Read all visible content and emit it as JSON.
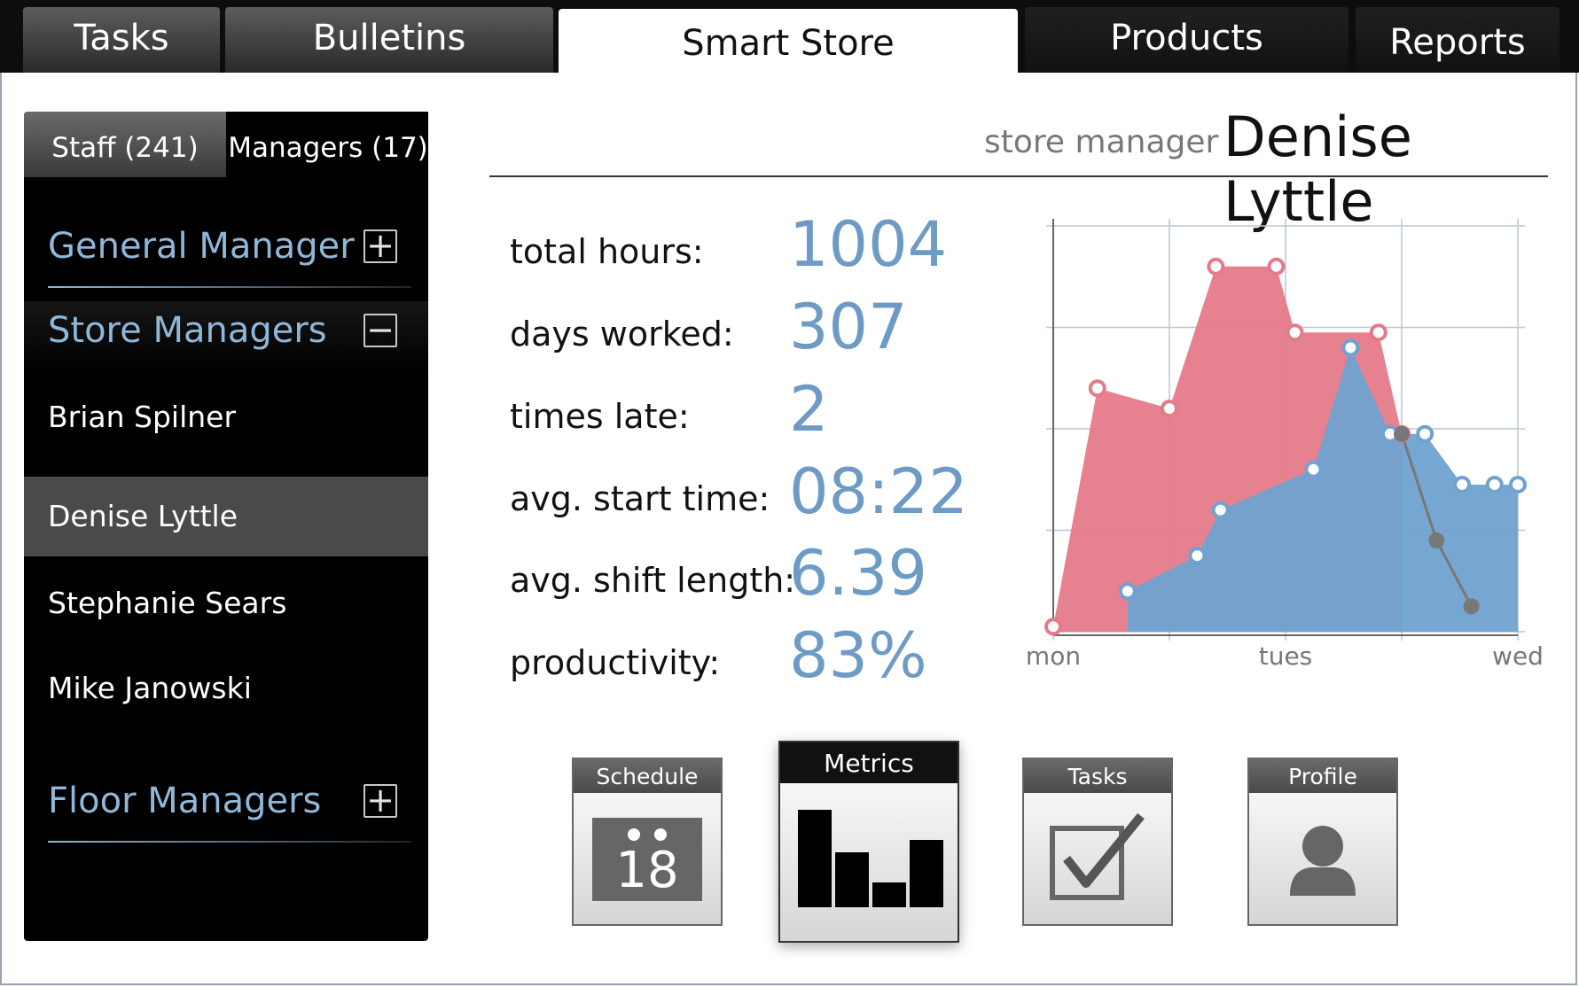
{
  "top_tabs": [
    {
      "label": "Tasks"
    },
    {
      "label": "Bulletins"
    },
    {
      "label": "Smart Store",
      "active": true
    },
    {
      "label": "Products"
    },
    {
      "label": "Reports"
    }
  ],
  "sidebar": {
    "subtabs": [
      {
        "label": "Staff (241)"
      },
      {
        "label": "Managers (17)",
        "active": true
      }
    ],
    "sections": {
      "general": {
        "label": "General Manager",
        "toggle": "+"
      },
      "store": {
        "label": "Store Managers",
        "toggle": "−"
      },
      "floor": {
        "label": "Floor Managers",
        "toggle": "+"
      }
    },
    "people": [
      "Brian Spilner",
      "Denise Lyttle",
      "Stephanie Sears",
      "Mike Janowski"
    ],
    "selected_person": "Denise Lyttle"
  },
  "header": {
    "role": "store manager",
    "name": "Denise Lyttle"
  },
  "stats": [
    {
      "label": "total hours:",
      "value": "1004"
    },
    {
      "label": "days worked:",
      "value": "307"
    },
    {
      "label": "times late:",
      "value": "2"
    },
    {
      "label": "avg. start time:",
      "value": "08:22"
    },
    {
      "label": "avg. shift length:",
      "value": "6.39"
    },
    {
      "label": "productivity:",
      "value": "83%"
    }
  ],
  "cards": {
    "schedule": {
      "label": "Schedule",
      "day": "18",
      "icon": "calendar-icon"
    },
    "metrics": {
      "label": "Metrics",
      "icon": "bar-chart-icon"
    },
    "tasks": {
      "label": "Tasks",
      "icon": "checkbox-icon"
    },
    "profile": {
      "label": "Profile",
      "icon": "person-icon"
    }
  },
  "colors": {
    "accent": "#6e9bc6",
    "pink": "#e57a8a",
    "blue": "#6fa2d0",
    "dark": "#000000"
  },
  "chart_data": {
    "type": "area",
    "categories": [
      "mon",
      "tues",
      "wed"
    ],
    "x_range": [
      0,
      2
    ],
    "ylim": [
      0,
      4
    ],
    "grid": true,
    "series": [
      {
        "color": "#e57a8a",
        "points": [
          [
            0,
            0.05
          ],
          [
            0.19,
            2.4
          ],
          [
            0.5,
            2.2
          ],
          [
            0.7,
            3.6
          ],
          [
            0.96,
            3.6
          ],
          [
            1.04,
            2.95
          ],
          [
            1.4,
            2.95
          ],
          [
            1.5,
            1.95
          ]
        ]
      },
      {
        "color": "#6fa2d0",
        "points": [
          [
            0.32,
            0.4
          ],
          [
            0.62,
            0.75
          ],
          [
            0.72,
            1.2
          ],
          [
            1.12,
            1.6
          ],
          [
            1.28,
            2.8
          ],
          [
            1.45,
            1.95
          ],
          [
            1.6,
            1.95
          ],
          [
            1.76,
            1.45
          ],
          [
            1.9,
            1.45
          ],
          [
            2.0,
            1.45
          ]
        ]
      },
      {
        "color": "#777777",
        "points": [
          [
            1.5,
            1.95
          ],
          [
            1.65,
            0.9
          ],
          [
            1.8,
            0.25
          ]
        ]
      }
    ]
  }
}
